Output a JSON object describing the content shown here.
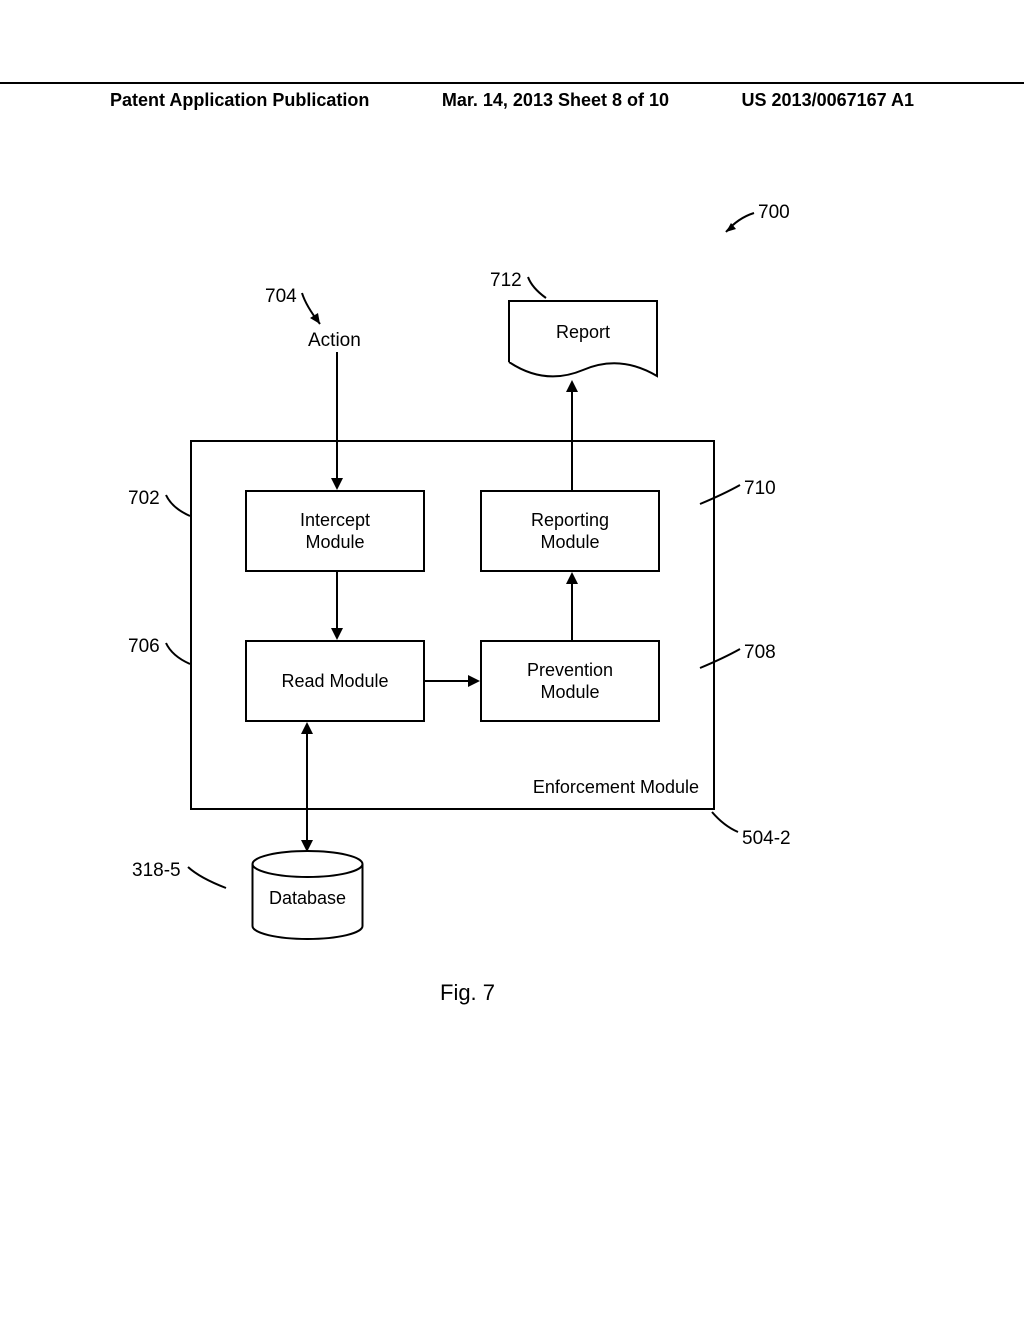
{
  "header": {
    "left": "Patent Application Publication",
    "center": "Mar. 14, 2013  Sheet 8 of 10",
    "right": "US 2013/0067167 A1"
  },
  "refs": {
    "system": "700",
    "action": "704",
    "report": "712",
    "intercept": "702",
    "reporting": "710",
    "read": "706",
    "prevention": "708",
    "enforcement": "504-2",
    "database": "318-5"
  },
  "nodes": {
    "action": "Action",
    "report": "Report",
    "intercept": "Intercept\nModule",
    "reporting": "Reporting\nModule",
    "read": "Read Module",
    "prevention": "Prevention\nModule",
    "enforcement": "Enforcement Module",
    "database": "Database"
  },
  "caption": "Fig. 7"
}
